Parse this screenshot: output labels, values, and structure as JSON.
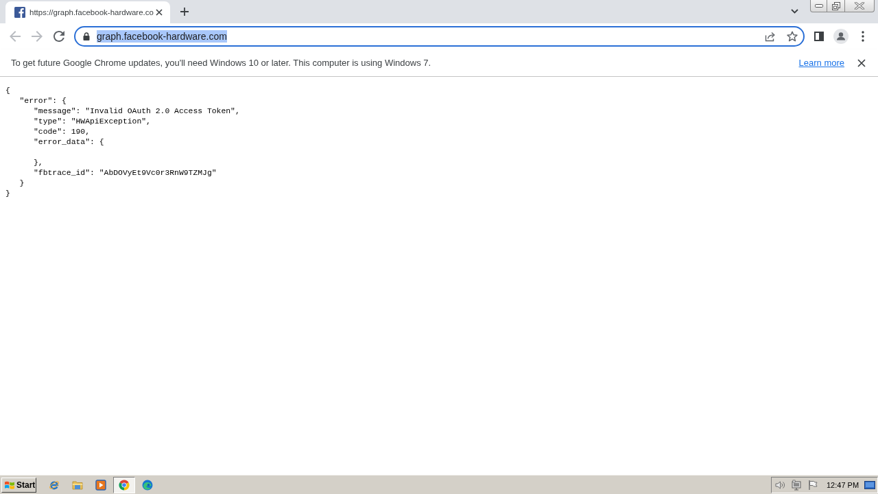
{
  "browser": {
    "tabs": [
      {
        "title": "https://graph.facebook-hardware.co",
        "selected": true
      }
    ],
    "address_bar": {
      "value": "graph.facebook-hardware.com",
      "text_selected": true
    }
  },
  "infobar": {
    "message": "To get future Google Chrome updates, you'll need Windows 10 or later. This computer is using Windows 7.",
    "link": "Learn more"
  },
  "page": {
    "body_text": "{\n   \"error\": {\n      \"message\": \"Invalid OAuth 2.0 Access Token\",\n      \"type\": \"HWApiException\",\n      \"code\": 190,\n      \"error_data\": {\n\n      },\n      \"fbtrace_id\": \"AbDOVyEt9Vc0r3RnW9TZMJg\"\n   }\n}"
  },
  "taskbar": {
    "start_label": "Start",
    "apps": [
      {
        "kind": "ie",
        "selected": false
      },
      {
        "kind": "folder",
        "selected": false
      },
      {
        "kind": "media",
        "selected": false
      },
      {
        "kind": "chrome",
        "selected": true
      },
      {
        "kind": "edge",
        "selected": false
      }
    ],
    "clock": "12:47 PM"
  }
}
